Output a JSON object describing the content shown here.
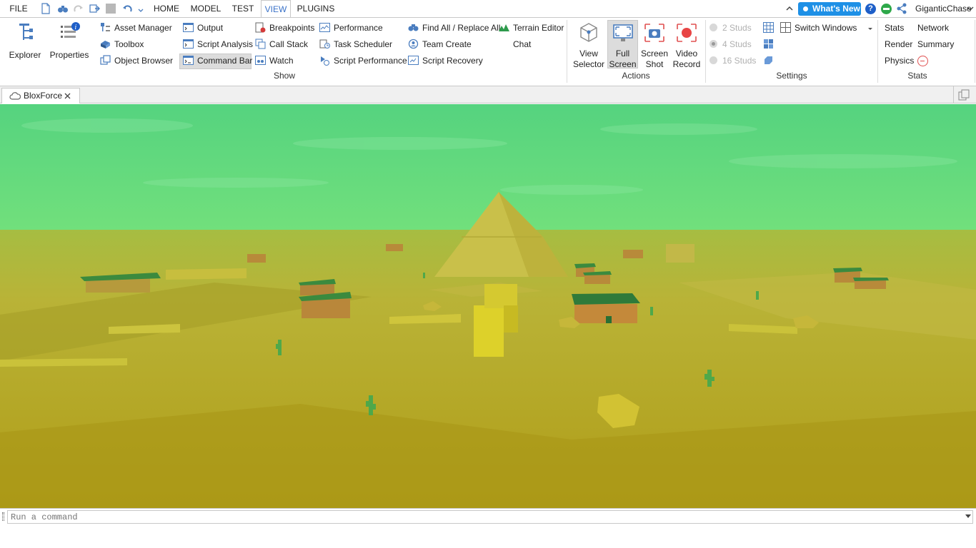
{
  "menu": {
    "file": "FILE",
    "tabs": [
      {
        "label": "HOME"
      },
      {
        "label": "MODEL"
      },
      {
        "label": "TEST"
      },
      {
        "label": "VIEW"
      },
      {
        "label": "PLUGINS"
      }
    ],
    "whats_new": "What's New",
    "username": "GiganticChase"
  },
  "ribbon": {
    "big": {
      "explorer": "Explorer",
      "properties": "Properties"
    },
    "col1": [
      "Asset Manager",
      "Toolbox",
      "Object Browser"
    ],
    "col2": [
      "Output",
      "Script Analysis",
      "Command Bar"
    ],
    "col3": [
      "Breakpoints",
      "Call Stack",
      "Watch"
    ],
    "col4": [
      "Performance",
      "Task Scheduler",
      "Script Performance"
    ],
    "col5": [
      "Find All / Replace All",
      "Team Create",
      "Script Recovery"
    ],
    "col6": [
      "Terrain Editor",
      "Chat"
    ],
    "show_group": "Show",
    "actions": {
      "view_selector_1": "View",
      "view_selector_2": "Selector",
      "full_screen_1": "Full",
      "full_screen_2": "Screen",
      "screen_shot_1": "Screen",
      "screen_shot_2": "Shot",
      "video_record_1": "Video",
      "video_record_2": "Record",
      "group": "Actions"
    },
    "settings": {
      "studs": [
        "2 Studs",
        "4 Studs",
        "16 Studs"
      ],
      "switch_windows": "Switch Windows",
      "group": "Settings"
    },
    "stats": {
      "stats": "Stats",
      "network": "Network",
      "render": "Render",
      "summary": "Summary",
      "physics": "Physics",
      "group": "Stats"
    }
  },
  "document": {
    "tab_title": "BloxForce"
  },
  "command_bar": {
    "placeholder": "Run a command"
  },
  "colors": {
    "accent": "#1e90e6",
    "sky_top": "#58d585",
    "ground": "#b8a820",
    "roof": "#2f7a3a"
  }
}
